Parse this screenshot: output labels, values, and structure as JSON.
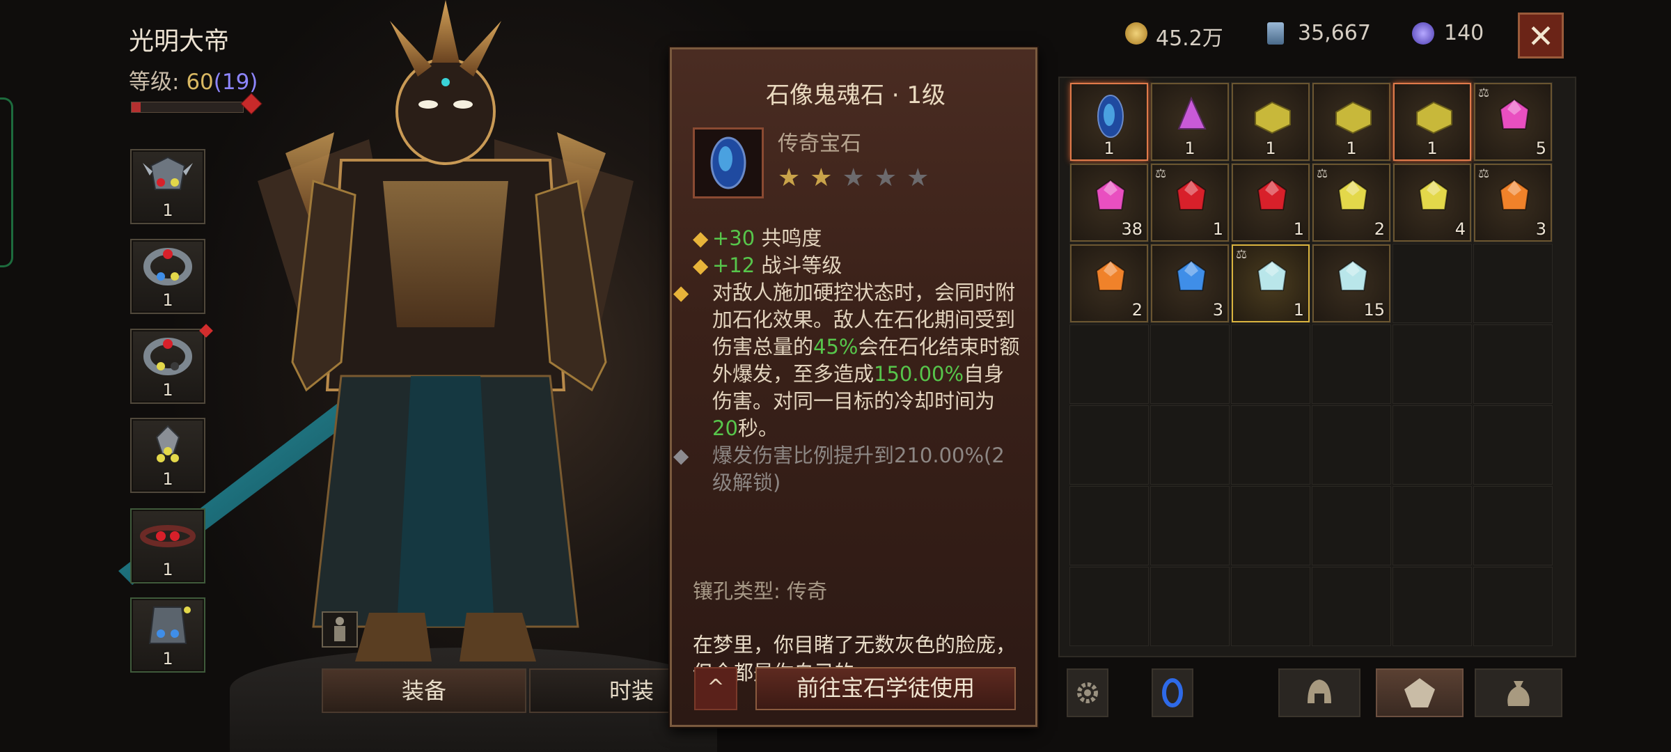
{
  "character": {
    "name": "光明大帝",
    "level_label": "等级: ",
    "level": "60",
    "paragon": "(19)",
    "xp_fraction": 0.08
  },
  "equipment_slots": [
    {
      "name": "helm-gem-slot",
      "count": "1"
    },
    {
      "name": "ring-slot-1",
      "count": "1"
    },
    {
      "name": "ring-slot-2",
      "count": "1",
      "badge": true
    },
    {
      "name": "amulet-slot",
      "count": "1"
    },
    {
      "name": "belt-slot",
      "count": "1"
    },
    {
      "name": "chest-slot",
      "count": "1"
    }
  ],
  "tabs": {
    "equip": "装备",
    "fashion": "时装"
  },
  "tooltip": {
    "title": "石像鬼魂石 · 1级",
    "subtitle": "传奇宝石",
    "stars_total": 5,
    "stars_filled": 2,
    "attr1_value": "+30",
    "attr1_text": " 共鸣度",
    "attr2_value": "+12",
    "attr2_text": " 战斗等级",
    "effect_p1": "对敌人施加硬控状态时，会同时附加石化效果。敌人在石化期间受到伤害总量的",
    "effect_v1": "45%",
    "effect_p2": "会在石化结束时额外爆发，至多造成",
    "effect_v2": "150.00%",
    "effect_p3": "自身伤害。对同一目标的冷却时间为",
    "effect_v3": "20",
    "effect_p4": "秒。",
    "locked_text": "爆发伤害比例提升到210.00%(2级解锁)",
    "socket_label": "镶孔类型: 传奇",
    "lore": "在梦里，你目睹了无数灰色的脸庞，但全都是你自己的。",
    "collapse_icon": "^",
    "goto_button": "前往宝石学徒使用"
  },
  "currency": {
    "gold": "45.2万",
    "platinum": "35,667",
    "orbs": "140"
  },
  "close_icon": "✕",
  "inventory": [
    {
      "gem": "legendary-blue",
      "qty": "1",
      "sel": true,
      "center": true
    },
    {
      "gem": "pink-crystal",
      "qty": "1",
      "center": true
    },
    {
      "gem": "gold-block",
      "qty": "1",
      "center": true
    },
    {
      "gem": "gold-block",
      "qty": "1",
      "center": true
    },
    {
      "gem": "gold-block",
      "qty": "1",
      "sel": true,
      "center": true
    },
    {
      "gem": "amethyst",
      "qty": "5",
      "lock": true
    },
    {
      "gem": "amethyst",
      "qty": "38"
    },
    {
      "gem": "ruby",
      "qty": "1",
      "lock": true
    },
    {
      "gem": "ruby",
      "qty": "1"
    },
    {
      "gem": "topaz",
      "qty": "2",
      "lock": true
    },
    {
      "gem": "topaz",
      "qty": "4"
    },
    {
      "gem": "amber",
      "qty": "3",
      "lock": true
    },
    {
      "gem": "amber",
      "qty": "2"
    },
    {
      "gem": "sapphire",
      "qty": "3"
    },
    {
      "gem": "diamond",
      "qty": "1",
      "lock": true,
      "lockedsel": true
    },
    {
      "gem": "diamond",
      "qty": "15"
    }
  ],
  "colors": {
    "amethyst": "#e94fc0",
    "ruby": "#d8202a",
    "topaz": "#e3d84a",
    "amber": "#f0822a",
    "sapphire": "#3f8ee8",
    "diamond": "#b9e6ea",
    "pink-crystal": "#c85ad8",
    "gold-block": "#c8b83a",
    "legendary-blue": "#3a7ad8"
  },
  "toolbar": [
    {
      "name": "settings-gear-icon"
    },
    {
      "name": "blue-portal-icon"
    },
    {
      "name": "helmet-category-icon"
    },
    {
      "name": "gem-category-icon",
      "active": true
    },
    {
      "name": "bag-category-icon"
    }
  ]
}
